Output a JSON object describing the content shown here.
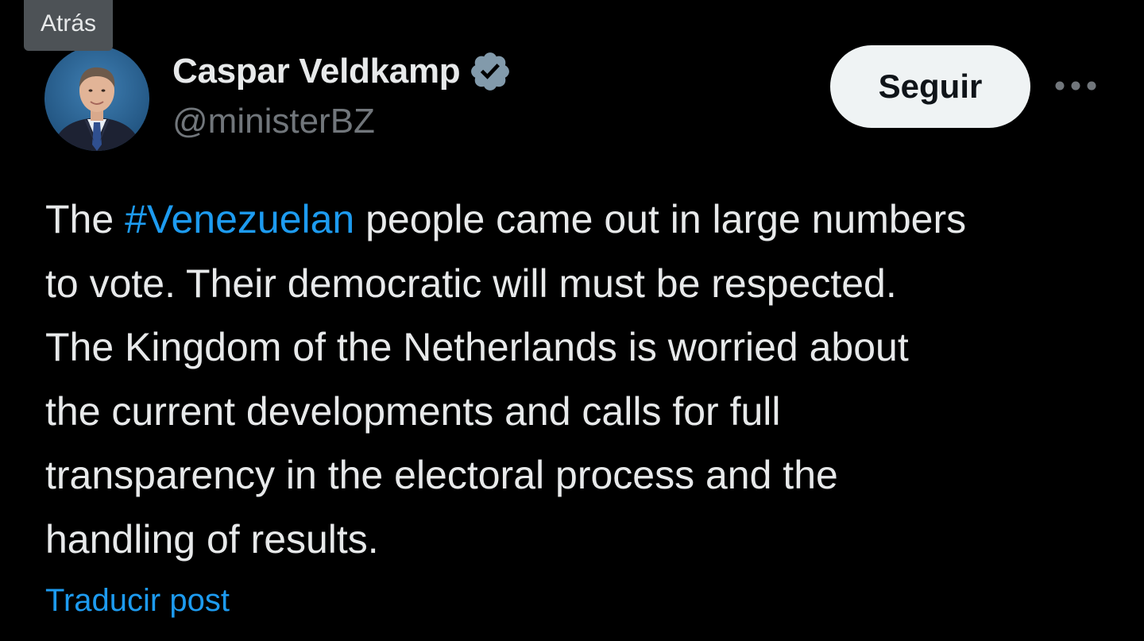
{
  "tooltip": {
    "label": "Atrás"
  },
  "author": {
    "display_name": "Caspar Veldkamp",
    "handle": "@ministerBZ",
    "verified": true,
    "verified_badge_color": "#829aab"
  },
  "actions": {
    "follow_label": "Seguir",
    "more_icon": "more-horizontal-icon"
  },
  "post": {
    "line_1_before": "The ",
    "hashtag": "#Venezuelan",
    "line_1_after": " people came out in large numbers",
    "line_2": "to vote. Their democratic will must be respected.",
    "line_3": "The Kingdom of the Netherlands is worried about",
    "line_4": "the current developments and calls for full",
    "line_5": "transparency in the electoral process and the",
    "line_6": "handling of results."
  },
  "translate": {
    "label": "Traducir post"
  },
  "colors": {
    "background": "#000000",
    "text": "#e7e9ea",
    "secondary_text": "#71767b",
    "link": "#1d9bf0",
    "follow_button_bg": "#eff3f4"
  }
}
